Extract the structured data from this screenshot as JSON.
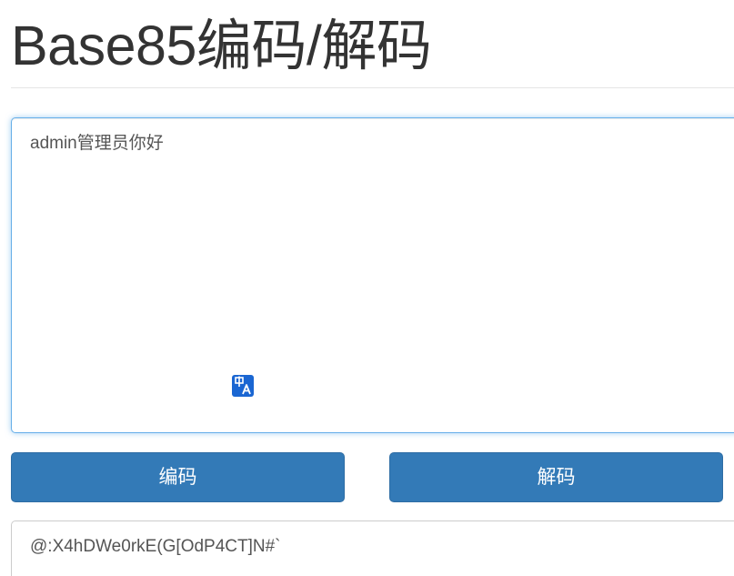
{
  "page": {
    "title": "Base85编码/解码"
  },
  "input": {
    "value": "admin管理员你好"
  },
  "translate_badge": {
    "icon": "translate-icon",
    "color": "#1a66d2"
  },
  "buttons": {
    "encode_label": "编码",
    "decode_label": "解码",
    "color": "#337ab7"
  },
  "output": {
    "value": "@:X4hDWe0rkE(G[OdP4CT]N#`"
  },
  "colors": {
    "focus_border": "#66afe9",
    "text": "#333333"
  }
}
